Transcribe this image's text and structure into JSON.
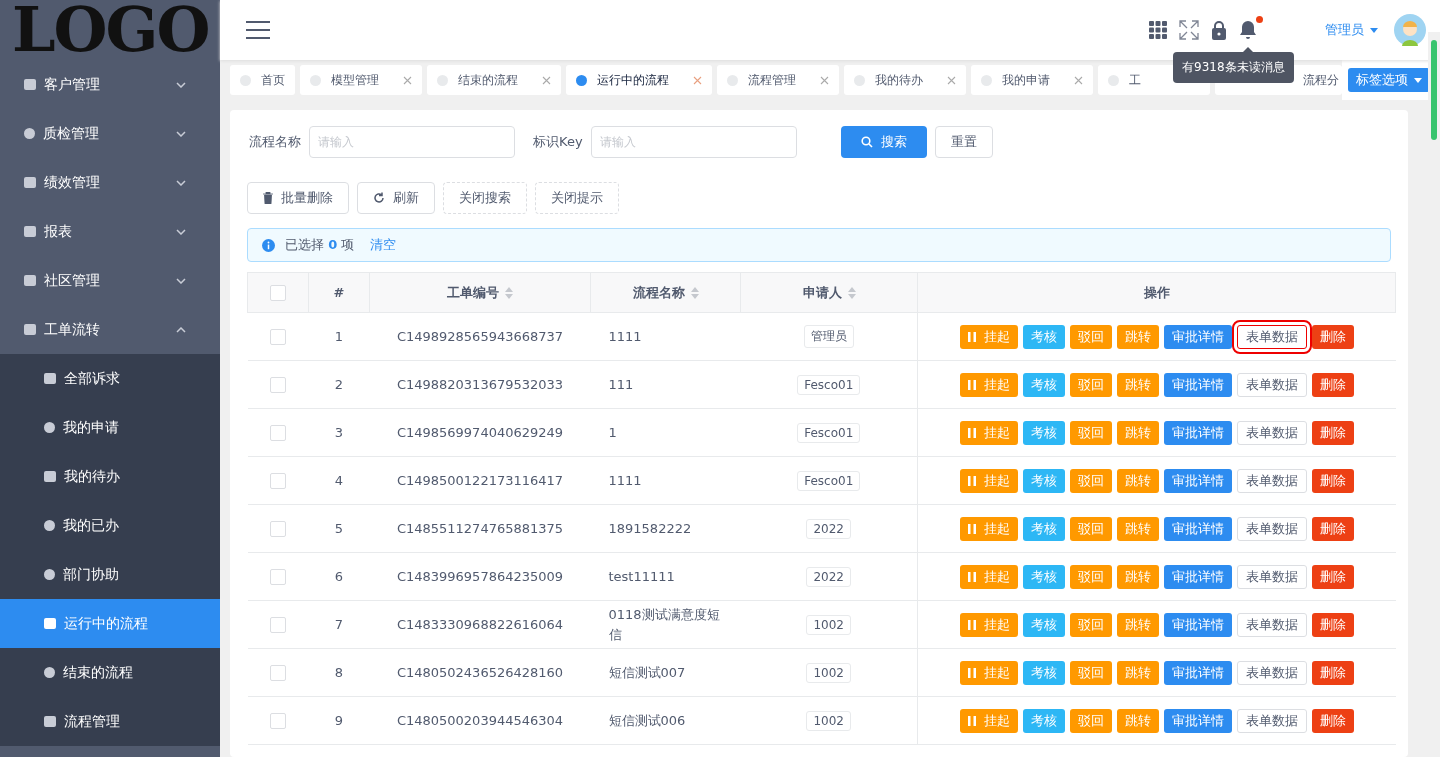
{
  "logo": "LOGO",
  "sidebar": {
    "items": [
      {
        "label": "客户管理",
        "expanded": false
      },
      {
        "label": "质检管理",
        "expanded": false
      },
      {
        "label": "绩效管理",
        "expanded": false
      },
      {
        "label": "报表",
        "expanded": false
      },
      {
        "label": "社区管理",
        "expanded": false
      },
      {
        "label": "工单流转",
        "expanded": true,
        "children": [
          {
            "label": "全部诉求",
            "selected": false
          },
          {
            "label": "我的申请",
            "selected": false
          },
          {
            "label": "我的待办",
            "selected": false
          },
          {
            "label": "我的已办",
            "selected": false
          },
          {
            "label": "部门协助",
            "selected": false
          },
          {
            "label": "运行中的流程",
            "selected": true
          },
          {
            "label": "结束的流程",
            "selected": false
          },
          {
            "label": "流程管理",
            "selected": false
          }
        ]
      }
    ]
  },
  "header": {
    "user": "管理员",
    "tooltip": "有9318条未读消息"
  },
  "tabs": [
    {
      "label": "首页",
      "selected": false,
      "closable": false
    },
    {
      "label": "模型管理",
      "selected": false,
      "closable": true
    },
    {
      "label": "结束的流程",
      "selected": false,
      "closable": true
    },
    {
      "label": "运行中的流程",
      "selected": true,
      "closable": true
    },
    {
      "label": "流程管理",
      "selected": false,
      "closable": true
    },
    {
      "label": "我的待办",
      "selected": false,
      "closable": true
    },
    {
      "label": "我的申请",
      "selected": false,
      "closable": true
    },
    {
      "label": "工",
      "selected": false
    },
    {
      "label": "流程分",
      "selected": false
    }
  ],
  "tab_options": "标签选项",
  "search": {
    "fields": [
      {
        "label": "流程名称",
        "placeholder": "请输入"
      },
      {
        "label": "标识Key",
        "placeholder": "请输入"
      }
    ],
    "search_button": "搜索",
    "reset_button": "重置"
  },
  "toolbar": [
    {
      "label": "批量删除",
      "kind": "delete"
    },
    {
      "label": "刷新",
      "kind": "refresh"
    },
    {
      "label": "关闭搜索",
      "kind": "dashed"
    },
    {
      "label": "关闭提示",
      "kind": "dashed"
    }
  ],
  "alert": {
    "prefix": "已选择",
    "count": "0",
    "suffix": "项",
    "clear": "清空"
  },
  "table": {
    "all_checked": false,
    "columns": [
      {
        "label": "#",
        "sortable": false
      },
      {
        "label": "工单编号",
        "sortable": true
      },
      {
        "label": "流程名称",
        "sortable": true
      },
      {
        "label": "申请人",
        "sortable": true
      },
      {
        "label": "操作",
        "sortable": false
      }
    ],
    "rows": [
      {
        "index": "1",
        "id": "C1498928565943668737",
        "name": "1111",
        "applicant": "管理员",
        "checked": false,
        "actions": [
          {
            "label": "挂起",
            "kind": "pause"
          },
          {
            "label": "考核",
            "kind": "info"
          },
          {
            "label": "驳回",
            "kind": "warning"
          },
          {
            "label": "跳转",
            "kind": "warning"
          },
          {
            "label": "审批详情",
            "kind": "primary"
          },
          {
            "label": "表单数据",
            "kind": "default",
            "outlined": true
          },
          {
            "label": "删除",
            "kind": "error"
          }
        ]
      },
      {
        "index": "2",
        "id": "C1498820313679532033",
        "name": "111",
        "applicant": "Fesco01",
        "checked": false,
        "actions": [
          {
            "label": "挂起",
            "kind": "pause"
          },
          {
            "label": "考核",
            "kind": "info"
          },
          {
            "label": "驳回",
            "kind": "warning"
          },
          {
            "label": "跳转",
            "kind": "warning"
          },
          {
            "label": "审批详情",
            "kind": "primary"
          },
          {
            "label": "表单数据",
            "kind": "default",
            "outlined": false
          },
          {
            "label": "删除",
            "kind": "error"
          }
        ]
      },
      {
        "index": "3",
        "id": "C1498569974040629249",
        "name": "1",
        "applicant": "Fesco01",
        "checked": false,
        "actions": [
          {
            "label": "挂起",
            "kind": "pause"
          },
          {
            "label": "考核",
            "kind": "info"
          },
          {
            "label": "驳回",
            "kind": "warning"
          },
          {
            "label": "跳转",
            "kind": "warning"
          },
          {
            "label": "审批详情",
            "kind": "primary"
          },
          {
            "label": "表单数据",
            "kind": "default",
            "outlined": false
          },
          {
            "label": "删除",
            "kind": "error"
          }
        ]
      },
      {
        "index": "4",
        "id": "C1498500122173116417",
        "name": "1111",
        "applicant": "Fesco01",
        "checked": false,
        "actions": [
          {
            "label": "挂起",
            "kind": "pause"
          },
          {
            "label": "考核",
            "kind": "info"
          },
          {
            "label": "驳回",
            "kind": "warning"
          },
          {
            "label": "跳转",
            "kind": "warning"
          },
          {
            "label": "审批详情",
            "kind": "primary"
          },
          {
            "label": "表单数据",
            "kind": "default",
            "outlined": false
          },
          {
            "label": "删除",
            "kind": "error"
          }
        ]
      },
      {
        "index": "5",
        "id": "C1485511274765881375",
        "name": "1891582222",
        "applicant": "2022",
        "checked": false,
        "actions": [
          {
            "label": "挂起",
            "kind": "pause"
          },
          {
            "label": "考核",
            "kind": "info"
          },
          {
            "label": "驳回",
            "kind": "warning"
          },
          {
            "label": "跳转",
            "kind": "warning"
          },
          {
            "label": "审批详情",
            "kind": "primary"
          },
          {
            "label": "表单数据",
            "kind": "default",
            "outlined": false
          },
          {
            "label": "删除",
            "kind": "error"
          }
        ]
      },
      {
        "index": "6",
        "id": "C1483996957864235009",
        "name": "test11111",
        "applicant": "2022",
        "checked": false,
        "actions": [
          {
            "label": "挂起",
            "kind": "pause"
          },
          {
            "label": "考核",
            "kind": "info"
          },
          {
            "label": "驳回",
            "kind": "warning"
          },
          {
            "label": "跳转",
            "kind": "warning"
          },
          {
            "label": "审批详情",
            "kind": "primary"
          },
          {
            "label": "表单数据",
            "kind": "default",
            "outlined": false
          },
          {
            "label": "删除",
            "kind": "error"
          }
        ]
      },
      {
        "index": "7",
        "id": "C1483330968822616064",
        "name": "0118测试满意度短信",
        "applicant": "1002",
        "checked": false,
        "actions": [
          {
            "label": "挂起",
            "kind": "pause"
          },
          {
            "label": "考核",
            "kind": "info"
          },
          {
            "label": "驳回",
            "kind": "warning"
          },
          {
            "label": "跳转",
            "kind": "warning"
          },
          {
            "label": "审批详情",
            "kind": "primary"
          },
          {
            "label": "表单数据",
            "kind": "default",
            "outlined": false
          },
          {
            "label": "删除",
            "kind": "error"
          }
        ]
      },
      {
        "index": "8",
        "id": "C1480502436526428160",
        "name": "短信测试007",
        "applicant": "1002",
        "checked": false,
        "actions": [
          {
            "label": "挂起",
            "kind": "pause"
          },
          {
            "label": "考核",
            "kind": "info"
          },
          {
            "label": "驳回",
            "kind": "warning"
          },
          {
            "label": "跳转",
            "kind": "warning"
          },
          {
            "label": "审批详情",
            "kind": "primary"
          },
          {
            "label": "表单数据",
            "kind": "default",
            "outlined": false
          },
          {
            "label": "删除",
            "kind": "error"
          }
        ]
      },
      {
        "index": "9",
        "id": "C1480500203944546304",
        "name": "短信测试006",
        "applicant": "1002",
        "checked": false,
        "actions": [
          {
            "label": "挂起",
            "kind": "pause"
          },
          {
            "label": "考核",
            "kind": "info"
          },
          {
            "label": "驳回",
            "kind": "warning"
          },
          {
            "label": "跳转",
            "kind": "warning"
          },
          {
            "label": "审批详情",
            "kind": "primary"
          },
          {
            "label": "表单数据",
            "kind": "default",
            "outlined": false
          },
          {
            "label": "删除",
            "kind": "error"
          }
        ]
      }
    ]
  }
}
